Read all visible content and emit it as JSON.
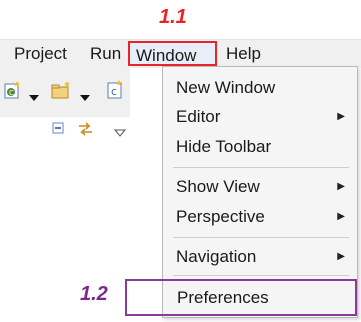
{
  "annotations": {
    "step1": "1.1",
    "step2": "1.2",
    "step1_color": "#e8242a",
    "step2_color": "#7a2a8c"
  },
  "menubar": {
    "items": [
      "Project",
      "Run",
      "Window",
      "Help"
    ],
    "active": "Window"
  },
  "toolbar": {
    "icons": [
      "new-class-icon",
      "dropdown-arrow-icon",
      "new-package-icon",
      "dropdown-arrow-icon",
      "new-type-icon"
    ]
  },
  "view": {
    "icons": [
      "collapse-all-icon",
      "link-with-editor-icon",
      "view-menu-icon"
    ]
  },
  "window_menu": {
    "items": [
      {
        "label": "New Window",
        "submenu": false
      },
      {
        "label": "Editor",
        "submenu": true
      },
      {
        "label": "Hide Toolbar",
        "submenu": false
      },
      {
        "label": "Show View",
        "submenu": true
      },
      {
        "label": "Perspective",
        "submenu": true
      },
      {
        "label": "Navigation",
        "submenu": true
      },
      {
        "label": "Preferences",
        "submenu": false
      }
    ]
  }
}
